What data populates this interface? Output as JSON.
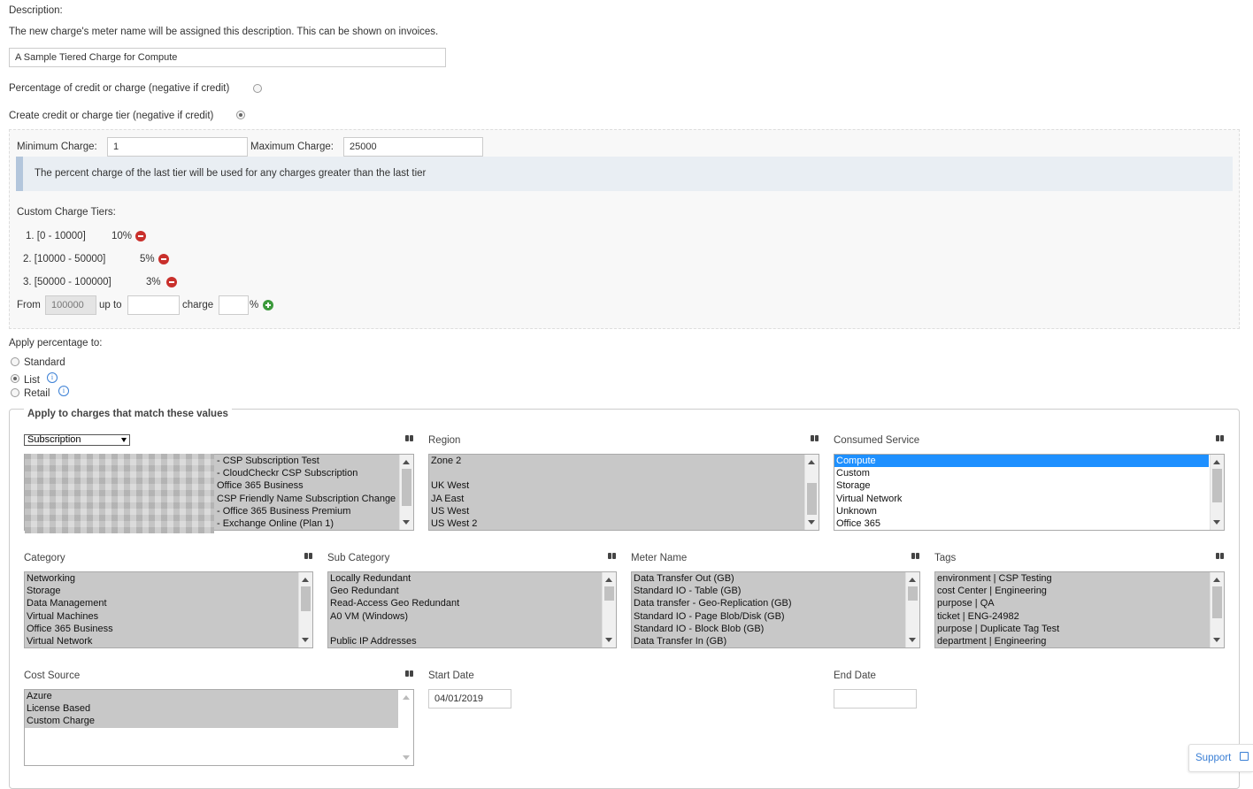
{
  "description": {
    "label": "Description:",
    "help": "The new charge's meter name will be assigned this description. This can be shown on invoices.",
    "value": "A Sample Tiered Charge for Compute"
  },
  "mode_options": {
    "percentage_label": "Percentage of credit or charge (negative if credit)",
    "tier_label": "Create credit or charge tier (negative if credit)",
    "selected": "tier"
  },
  "tier_panel": {
    "min_label": "Minimum Charge:",
    "min_value": "1",
    "max_label": "Maximum Charge:",
    "max_value": "25000",
    "info": "The percent charge of the last tier will be used for any charges greater than the last tier",
    "tiers_label": "Custom Charge Tiers:",
    "tiers": [
      {
        "range": "1. [0 - 10000]",
        "percent": "10%"
      },
      {
        "range": "2. [10000 - 50000]",
        "percent": "5%"
      },
      {
        "range": "3. [50000 - 100000]",
        "percent": "3%"
      }
    ],
    "new_tier": {
      "from_label": "From",
      "from_value": "100000",
      "upto_label": "up to",
      "upto_value": "",
      "charge_label": "charge",
      "charge_value": "",
      "percent_sign": "%"
    }
  },
  "apply_percentage": {
    "label": "Apply percentage to:",
    "options": [
      "Standard",
      "List",
      "Retail"
    ],
    "selected": "List"
  },
  "match": {
    "legend": "Apply to charges that match these values",
    "account_select": "Subscription",
    "accounts": [
      "- CSP Subscription Test",
      "- CloudCheckr CSP Subscription",
      "Office 365 Business",
      "CSP Friendly Name Subscription Change",
      "- Office 365 Business Premium",
      "- Exchange Online (Plan 1)"
    ],
    "region": {
      "label": "Region",
      "items": [
        "Zone 2",
        "",
        "UK West",
        "JA East",
        "US West",
        "US West 2"
      ]
    },
    "consumed_service": {
      "label": "Consumed Service",
      "items": [
        "Compute",
        "Custom",
        "Storage",
        "Virtual Network",
        "Unknown",
        "Office 365"
      ],
      "selected": "Compute"
    },
    "category": {
      "label": "Category",
      "items": [
        "Networking",
        "Storage",
        "Data Management",
        "Virtual Machines",
        "Office 365 Business",
        "Virtual Network"
      ]
    },
    "sub_category": {
      "label": "Sub Category",
      "items": [
        "Locally Redundant",
        "Geo Redundant",
        "Read-Access Geo Redundant",
        "A0 VM (Windows)",
        "",
        "Public IP Addresses"
      ]
    },
    "meter_name": {
      "label": "Meter Name",
      "items": [
        "Data Transfer Out (GB)",
        "Standard IO - Table (GB)",
        "Data transfer - Geo-Replication (GB)",
        "Standard IO - Page Blob/Disk (GB)",
        "Standard IO - Block Blob (GB)",
        "Data Transfer In (GB)"
      ]
    },
    "tags": {
      "label": "Tags",
      "items": [
        "environment | CSP Testing",
        "cost Center | Engineering",
        "purpose | QA",
        "ticket | ENG-24982",
        "purpose | Duplicate Tag Test",
        "department | Engineering"
      ]
    },
    "cost_source": {
      "label": "Cost Source",
      "items": [
        "Azure",
        "License Based",
        "Custom Charge"
      ]
    },
    "start_date": {
      "label": "Start Date",
      "value": "04/01/2019"
    },
    "end_date": {
      "label": "End Date",
      "value": ""
    }
  },
  "support": {
    "label": "Support"
  }
}
